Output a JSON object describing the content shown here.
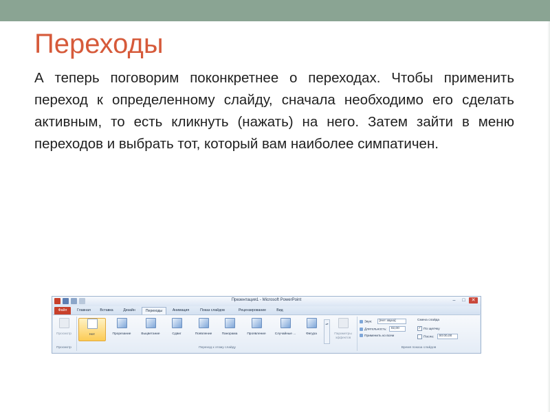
{
  "slide": {
    "title": "Переходы",
    "body": "А теперь поговорим поконкретнее о переходах. Чтобы применить переход к определенному слайду, сначала необходимо его сделать активным, то есть кликнуть (нажать) на него. Затем зайти в меню переходов и выбрать тот, который вам наиболее симпатичен."
  },
  "colors": {
    "top_bar": "#8aa493",
    "title": "#d65a3a",
    "file_tab": "#c8402b",
    "selected": "#fccb55"
  },
  "ribbon": {
    "window_title": "Презентация1 - Microsoft PowerPoint",
    "window_buttons": {
      "minimize": "–",
      "maximize": "□",
      "close": "✕"
    },
    "help_glyph": "?",
    "tabs": [
      "Файл",
      "Главная",
      "Вставка",
      "Дизайн",
      "Переходы",
      "Анимация",
      "Показ слайдов",
      "Рецензирование",
      "Вид"
    ],
    "preview_group": {
      "button": "Просмотр",
      "label": "Просмотр"
    },
    "transitions_group": {
      "items": [
        "Нет",
        "Прорезание",
        "Выцветание",
        "Сдвиг",
        "Появление",
        "Панорама",
        "Проявление",
        "Случайные ...",
        "Фигура"
      ],
      "effect_options": "Параметры эффектов",
      "label": "Переход к этому слайду"
    },
    "timing_group": {
      "sound_label": "Звук:",
      "sound_value": "[Нет звука]",
      "duration_label": "Длительность:",
      "duration_value": "02,00",
      "apply_all": "Применить ко всем",
      "advance_label": "Смена слайда",
      "on_click": "По щелчку",
      "after_label": "После:",
      "after_value": "00:00,00",
      "label": "Время показа слайдов"
    }
  }
}
